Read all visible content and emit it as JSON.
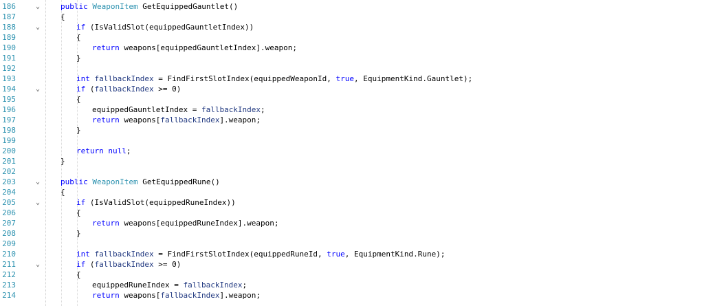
{
  "editor": {
    "lines": [
      {
        "num": "186",
        "fold": "⌄",
        "indent": 1,
        "tokens": [
          {
            "t": "public ",
            "c": "kw"
          },
          {
            "t": "WeaponItem ",
            "c": "ty"
          },
          {
            "t": "GetEquippedGauntlet()",
            "c": "plain"
          }
        ]
      },
      {
        "num": "187",
        "fold": "",
        "indent": 1,
        "tokens": [
          {
            "t": "{",
            "c": "plain"
          }
        ]
      },
      {
        "num": "188",
        "fold": "⌄",
        "indent": 2,
        "tokens": [
          {
            "t": "if ",
            "c": "kw"
          },
          {
            "t": "(IsValidSlot(equippedGauntletIndex))",
            "c": "plain"
          }
        ]
      },
      {
        "num": "189",
        "fold": "",
        "indent": 2,
        "tokens": [
          {
            "t": "{",
            "c": "plain"
          }
        ]
      },
      {
        "num": "190",
        "fold": "",
        "indent": 3,
        "tokens": [
          {
            "t": "return ",
            "c": "kw"
          },
          {
            "t": "weapons[equippedGauntletIndex].weapon;",
            "c": "plain"
          }
        ]
      },
      {
        "num": "191",
        "fold": "",
        "indent": 2,
        "tokens": [
          {
            "t": "}",
            "c": "plain"
          }
        ]
      },
      {
        "num": "192",
        "fold": "",
        "indent": 0,
        "tokens": []
      },
      {
        "num": "193",
        "fold": "",
        "indent": 2,
        "tokens": [
          {
            "t": "int ",
            "c": "kw"
          },
          {
            "t": "fallbackIndex",
            "c": "ident"
          },
          {
            "t": " = FindFirstSlotIndex(equippedWeaponId, ",
            "c": "plain"
          },
          {
            "t": "true",
            "c": "lit"
          },
          {
            "t": ", EquipmentKind.Gauntlet);",
            "c": "plain"
          }
        ]
      },
      {
        "num": "194",
        "fold": "⌄",
        "indent": 2,
        "tokens": [
          {
            "t": "if ",
            "c": "kw"
          },
          {
            "t": "(",
            "c": "plain"
          },
          {
            "t": "fallbackIndex",
            "c": "ident"
          },
          {
            "t": " >= 0)",
            "c": "plain"
          }
        ]
      },
      {
        "num": "195",
        "fold": "",
        "indent": 2,
        "tokens": [
          {
            "t": "{",
            "c": "plain"
          }
        ]
      },
      {
        "num": "196",
        "fold": "",
        "indent": 3,
        "tokens": [
          {
            "t": "equippedGauntletIndex = ",
            "c": "plain"
          },
          {
            "t": "fallbackIndex",
            "c": "ident"
          },
          {
            "t": ";",
            "c": "plain"
          }
        ]
      },
      {
        "num": "197",
        "fold": "",
        "indent": 3,
        "tokens": [
          {
            "t": "return ",
            "c": "kw"
          },
          {
            "t": "weapons[",
            "c": "plain"
          },
          {
            "t": "fallbackIndex",
            "c": "ident"
          },
          {
            "t": "].weapon;",
            "c": "plain"
          }
        ]
      },
      {
        "num": "198",
        "fold": "",
        "indent": 2,
        "tokens": [
          {
            "t": "}",
            "c": "plain"
          }
        ]
      },
      {
        "num": "199",
        "fold": "",
        "indent": 0,
        "tokens": []
      },
      {
        "num": "200",
        "fold": "",
        "indent": 2,
        "tokens": [
          {
            "t": "return ",
            "c": "kw"
          },
          {
            "t": "null",
            "c": "lit"
          },
          {
            "t": ";",
            "c": "plain"
          }
        ]
      },
      {
        "num": "201",
        "fold": "",
        "indent": 1,
        "tokens": [
          {
            "t": "}",
            "c": "plain"
          }
        ]
      },
      {
        "num": "202",
        "fold": "",
        "indent": 0,
        "tokens": []
      },
      {
        "num": "203",
        "fold": "⌄",
        "indent": 1,
        "tokens": [
          {
            "t": "public ",
            "c": "kw"
          },
          {
            "t": "WeaponItem ",
            "c": "ty"
          },
          {
            "t": "GetEquippedRune()",
            "c": "plain"
          }
        ]
      },
      {
        "num": "204",
        "fold": "",
        "indent": 1,
        "tokens": [
          {
            "t": "{",
            "c": "plain"
          }
        ]
      },
      {
        "num": "205",
        "fold": "⌄",
        "indent": 2,
        "tokens": [
          {
            "t": "if ",
            "c": "kw"
          },
          {
            "t": "(IsValidSlot(equippedRuneIndex))",
            "c": "plain"
          }
        ]
      },
      {
        "num": "206",
        "fold": "",
        "indent": 2,
        "tokens": [
          {
            "t": "{",
            "c": "plain"
          }
        ]
      },
      {
        "num": "207",
        "fold": "",
        "indent": 3,
        "tokens": [
          {
            "t": "return ",
            "c": "kw"
          },
          {
            "t": "weapons[equippedRuneIndex].weapon;",
            "c": "plain"
          }
        ]
      },
      {
        "num": "208",
        "fold": "",
        "indent": 2,
        "tokens": [
          {
            "t": "}",
            "c": "plain"
          }
        ]
      },
      {
        "num": "209",
        "fold": "",
        "indent": 0,
        "tokens": []
      },
      {
        "num": "210",
        "fold": "",
        "indent": 2,
        "tokens": [
          {
            "t": "int ",
            "c": "kw"
          },
          {
            "t": "fallbackIndex",
            "c": "ident"
          },
          {
            "t": " = FindFirstSlotIndex(equippedRuneId, ",
            "c": "plain"
          },
          {
            "t": "true",
            "c": "lit"
          },
          {
            "t": ", EquipmentKind.Rune);",
            "c": "plain"
          }
        ]
      },
      {
        "num": "211",
        "fold": "⌄",
        "indent": 2,
        "tokens": [
          {
            "t": "if ",
            "c": "kw"
          },
          {
            "t": "(",
            "c": "plain"
          },
          {
            "t": "fallbackIndex",
            "c": "ident"
          },
          {
            "t": " >= 0)",
            "c": "plain"
          }
        ]
      },
      {
        "num": "212",
        "fold": "",
        "indent": 2,
        "tokens": [
          {
            "t": "{",
            "c": "plain"
          }
        ]
      },
      {
        "num": "213",
        "fold": "",
        "indent": 3,
        "tokens": [
          {
            "t": "equippedRuneIndex = ",
            "c": "plain"
          },
          {
            "t": "fallbackIndex",
            "c": "ident"
          },
          {
            "t": ";",
            "c": "plain"
          }
        ]
      },
      {
        "num": "214",
        "fold": "",
        "indent": 3,
        "tokens": [
          {
            "t": "return ",
            "c": "kw"
          },
          {
            "t": "weapons[",
            "c": "plain"
          },
          {
            "t": "fallbackIndex",
            "c": "ident"
          },
          {
            "t": "].weapon;",
            "c": "plain"
          }
        ]
      }
    ]
  },
  "colors": {
    "keyword": "#0000ff",
    "type": "#2b91af",
    "line_number": "#2b91af",
    "identifier": "#1f377f",
    "text": "#000000",
    "background": "#ffffff"
  },
  "icons": {
    "fold": "chevron-down-icon"
  }
}
